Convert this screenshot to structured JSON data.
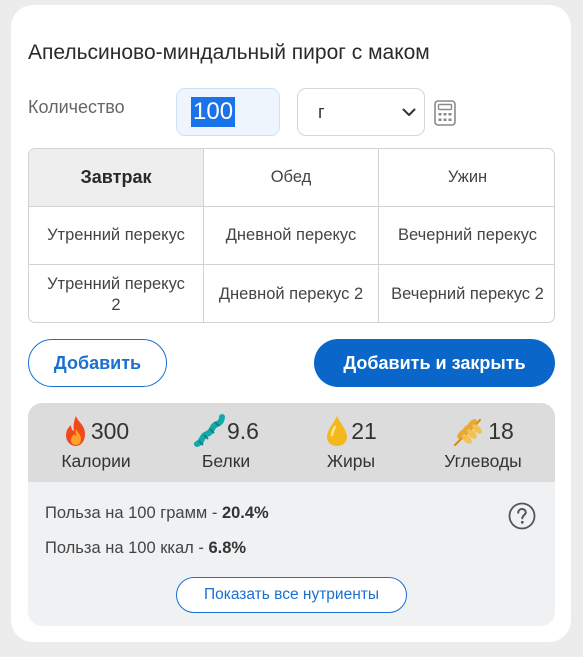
{
  "title": "Апельсиново-миндальный пирог с маком",
  "quantity": {
    "label": "Количество",
    "value": "100",
    "unit": "г",
    "calculator_icon": "calculator-icon"
  },
  "meals": {
    "rows": [
      [
        "Завтрак",
        "Обед",
        "Ужин"
      ],
      [
        "Утренний перекус",
        "Дневной перекус",
        "Вечерний перекус"
      ],
      [
        "Утренний перекус 2",
        "Дневной перекус 2",
        "Вечерний перекус 2"
      ]
    ],
    "selected": "Завтрак"
  },
  "buttons": {
    "add": "Добавить",
    "add_close": "Добавить и закрыть",
    "show_all": "Показать все нутриенты"
  },
  "macros": [
    {
      "icon": "flame-icon",
      "value": "300",
      "label": "Калории"
    },
    {
      "icon": "protein-icon",
      "value": "9.6",
      "label": "Белки"
    },
    {
      "icon": "fat-drop-icon",
      "value": "21",
      "label": "Жиры"
    },
    {
      "icon": "wheat-icon",
      "value": "18",
      "label": "Углеводы"
    }
  ],
  "benefit": {
    "per_100g_label": "Польза на 100 грамм - ",
    "per_100g_value": "20.4%",
    "per_100kcal_label": "Польза на 100 ккал - ",
    "per_100kcal_value": "6.8%",
    "help_icon": "help-icon"
  },
  "colors": {
    "primary": "#0a66c9",
    "accent_link": "#1a6fd1",
    "selection": "#1a73e8"
  }
}
